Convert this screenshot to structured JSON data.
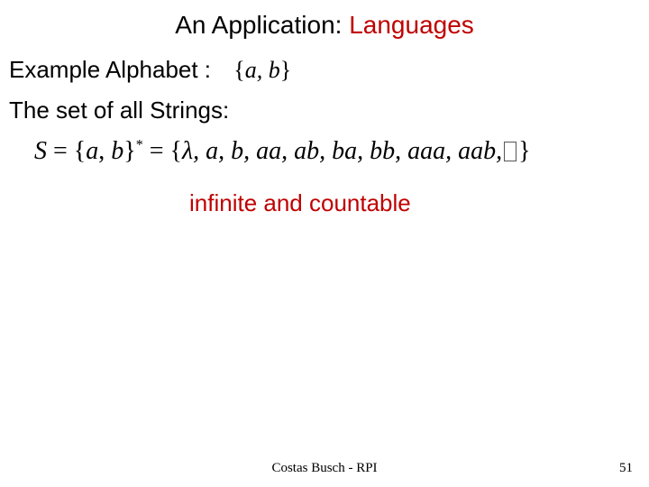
{
  "title_prefix": "An Application: ",
  "title_accent": "Languages",
  "example_label": "Example Alphabet :",
  "alphabet_math": "{a, b}",
  "strings_label": "The set of all Strings:",
  "eq_lhs_var": "S",
  "eq_lhs_set": "{a, b}",
  "eq_star": "*",
  "eq_rhs_open": "{",
  "eq_rhs_items": "λ, a, b, aa, ab, ba, bb, aaa, aab,",
  "eq_rhs_close": "}",
  "note": "infinite and countable",
  "footer_author": "Costas Busch - RPI",
  "footer_page": "51"
}
